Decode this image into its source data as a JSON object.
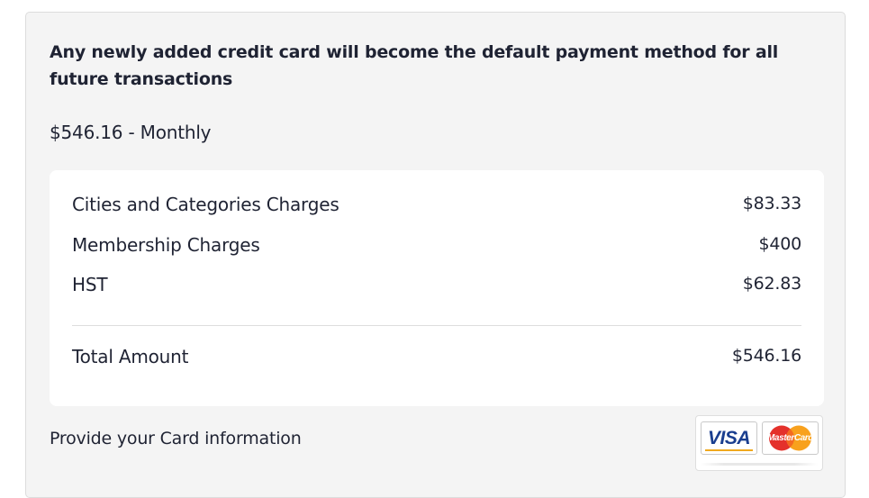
{
  "notice": "Any newly added credit card will become the default payment method for all future transactions",
  "plan_summary": "$546.16 - Monthly",
  "charges": [
    {
      "label": "Cities and Categories Charges",
      "amount": "$83.33"
    },
    {
      "label": "Membership Charges",
      "amount": "$400"
    },
    {
      "label": "HST",
      "amount": "$62.83"
    }
  ],
  "total": {
    "label": "Total Amount",
    "amount": "$546.16"
  },
  "card_prompt": "Provide your Card information",
  "card_brands": {
    "visa": "VISA",
    "mastercard": "MasterCard",
    "visa_color": "#1a3e8f",
    "mastercard_red": "#e4312b",
    "mastercard_orange": "#f8a11d"
  },
  "colors": {
    "panel_bg": "#f4f4f4",
    "text": "#1f2333"
  }
}
